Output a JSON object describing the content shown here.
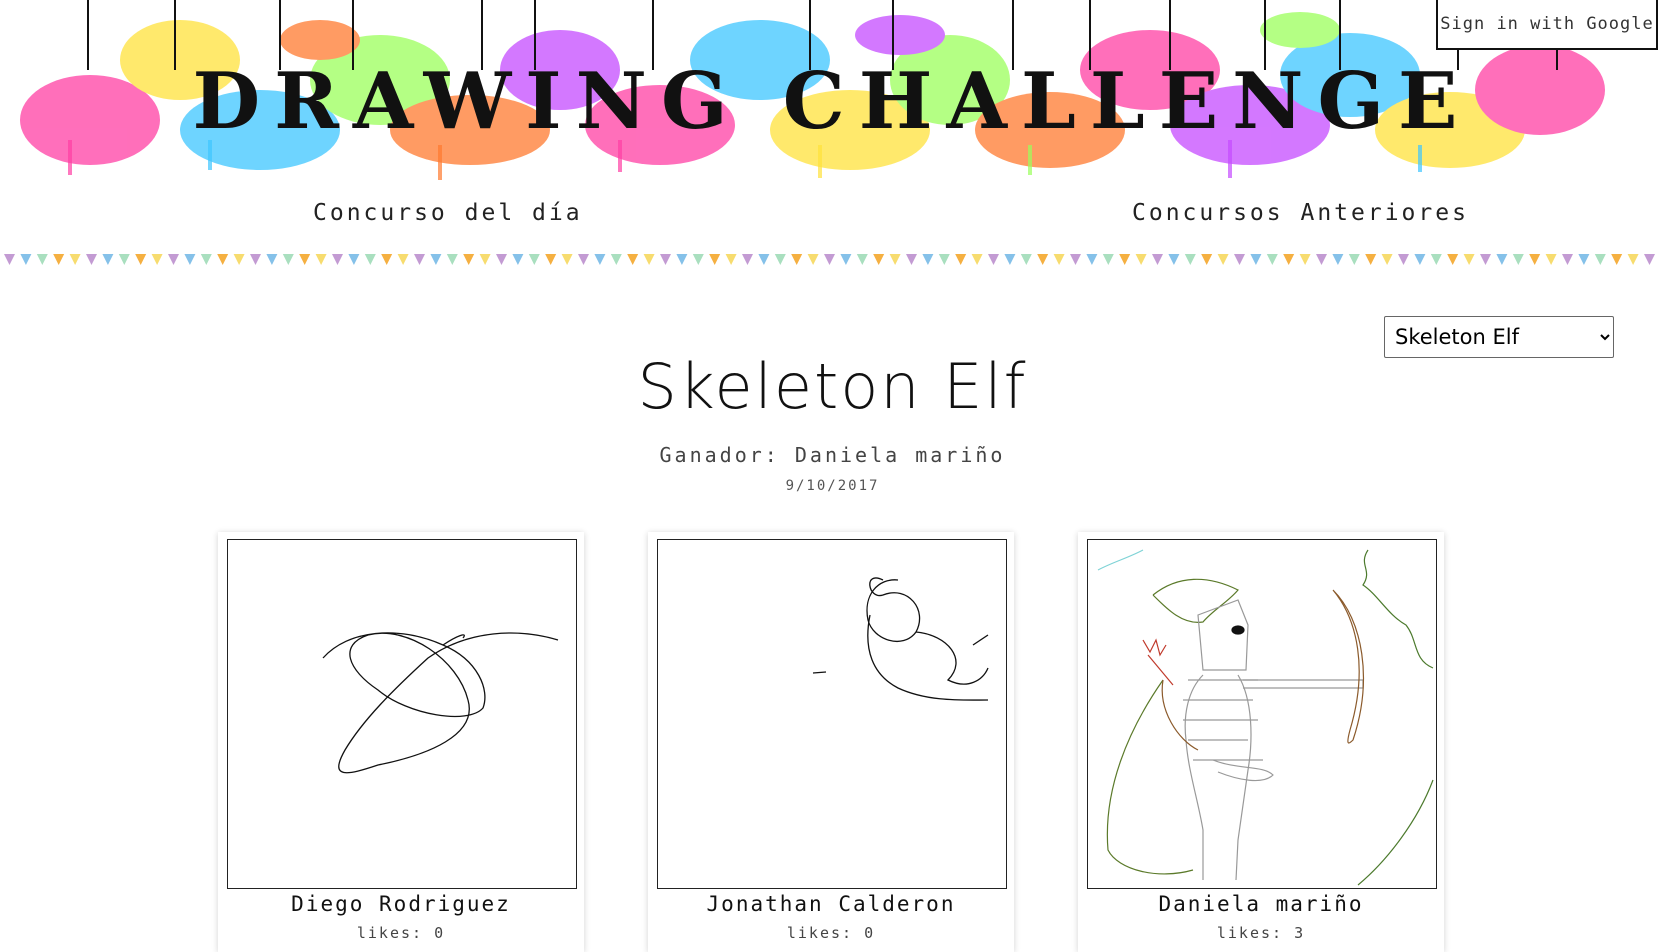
{
  "header": {
    "banner_text": "DRAWING CHALLENGE",
    "sign_in_label": "Sign in with Google"
  },
  "nav": {
    "items": [
      {
        "label": "Concurso del día"
      },
      {
        "label": "Concursos Anteriores"
      }
    ]
  },
  "contest": {
    "selected": "Skeleton Elf",
    "title": "Skeleton Elf",
    "winner": "Ganador: Daniela mariño",
    "date": "9/10/2017"
  },
  "drawings": [
    {
      "author": "Diego Rodriguez",
      "likes": "likes: 0"
    },
    {
      "author": "Jonathan Calderon",
      "likes": "likes: 0"
    },
    {
      "author": "Daniela mariño",
      "likes": "likes: 3"
    }
  ],
  "colors": {
    "bunting": [
      "#c39bd3",
      "#85c1e9",
      "#a9dfbf",
      "#f5b041",
      "#f7dc6f"
    ],
    "splash": [
      "#ff3fa4",
      "#3ec6ff",
      "#ffe23b",
      "#9bff5c",
      "#ff7a2f",
      "#c54bff"
    ]
  }
}
